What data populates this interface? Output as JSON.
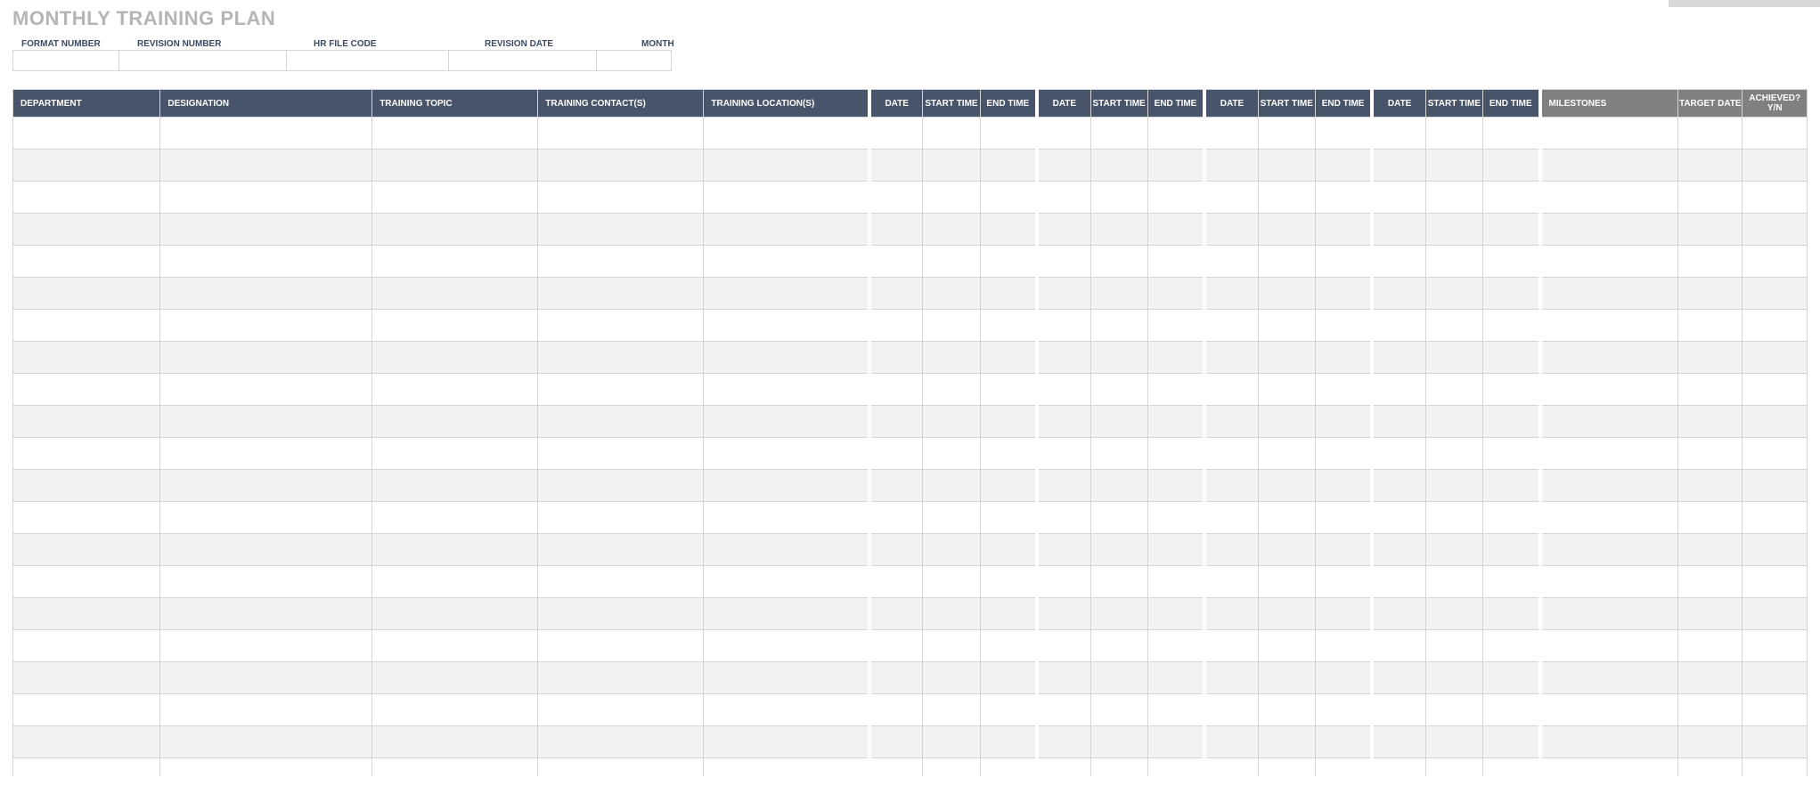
{
  "title": "MONTHLY TRAINING PLAN",
  "meta_labels": {
    "format_number": "FORMAT NUMBER",
    "revision_number": "REVISION NUMBER",
    "hr_file_code": "HR FILE CODE",
    "revision_date": "REVISION DATE",
    "month": "MONTH"
  },
  "meta_values": {
    "format_number": "",
    "revision_number": "",
    "hr_file_code": "",
    "revision_date": "",
    "month": ""
  },
  "columns": {
    "department": "DEPARTMENT",
    "designation": "DESIGNATION",
    "training_topic": "TRAINING TOPIC",
    "training_contacts": "TRAINING CONTACT(S)",
    "training_locations": "TRAINING LOCATION(S)",
    "date": "DATE",
    "start_time": "START TIME",
    "end_time": "END TIME",
    "milestones": "MILESTONES",
    "target_date": "TARGET DATE",
    "achieved": "ACHIEVED? Y/N"
  },
  "week_blocks": 4,
  "data_rows": 21
}
